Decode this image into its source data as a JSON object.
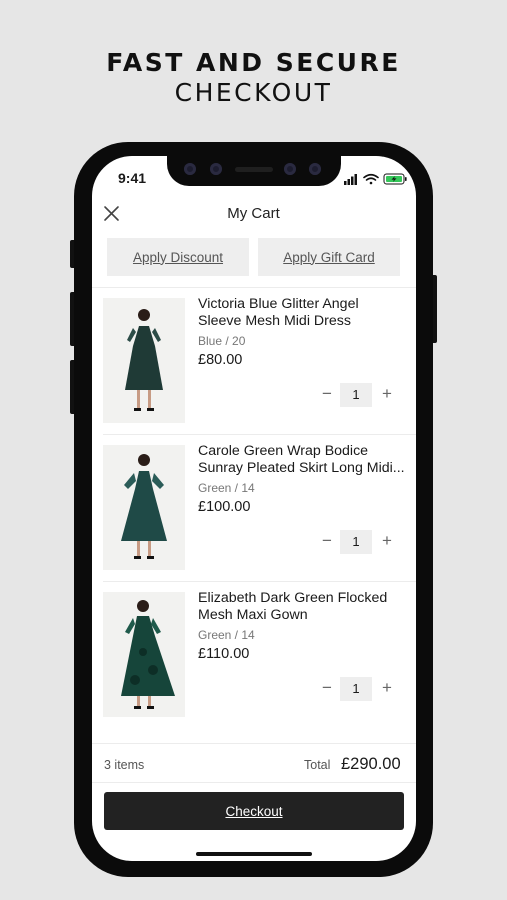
{
  "promo": {
    "line1": "FAST AND SECURE",
    "line2": "CHECKOUT"
  },
  "status_bar": {
    "time": "9:41",
    "icons": [
      "signal-icon",
      "wifi-icon",
      "battery-charging-icon"
    ]
  },
  "header": {
    "title": "My Cart",
    "close_icon": "close-icon"
  },
  "actions": {
    "apply_discount": "Apply Discount",
    "apply_gift_card": "Apply Gift Card"
  },
  "items": [
    {
      "title_l1": "Victoria Blue Glitter Angel",
      "title_l2": "Sleeve Mesh Midi Dress",
      "variant": "Blue / 20",
      "price": "£80.00",
      "qty": "1",
      "dress_color": "#1f3a36"
    },
    {
      "title_l1": "Carole Green Wrap Bodice",
      "title_l2": "Sunray Pleated Skirt Long Midi...",
      "variant": "Green / 14",
      "price": "£100.00",
      "qty": "1",
      "dress_color": "#1f4a47"
    },
    {
      "title_l1": "Elizabeth Dark Green Flocked",
      "title_l2": "Mesh Maxi Gown",
      "variant": "Green / 14",
      "price": "£110.00",
      "qty": "1",
      "dress_color": "#16453a"
    }
  ],
  "stepper": {
    "minus": "−",
    "plus": "+"
  },
  "summary": {
    "items_count": "3 items",
    "total_label": "Total",
    "total_value": "£290.00"
  },
  "checkout": {
    "label": "Checkout"
  }
}
